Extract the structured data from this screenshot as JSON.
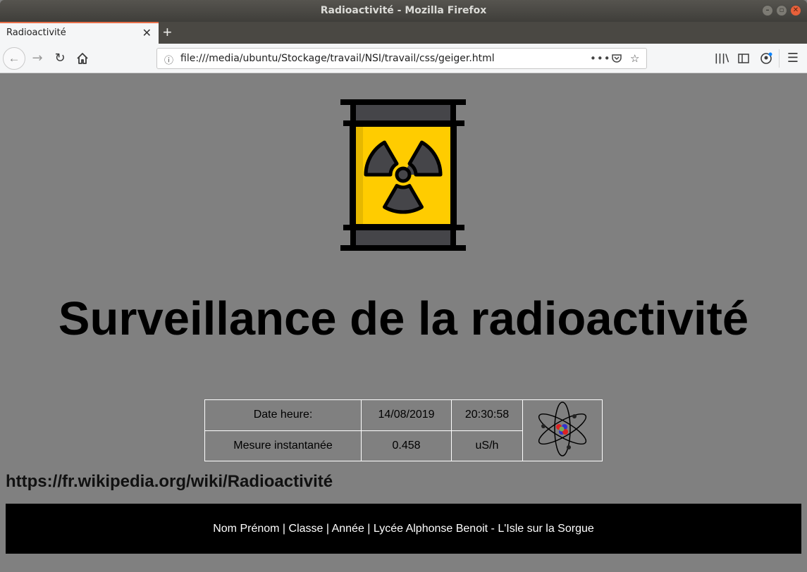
{
  "window": {
    "title": "Radioactivité - Mozilla Firefox"
  },
  "tabs": [
    {
      "label": "Radioactivité",
      "active": true
    }
  ],
  "toolbar": {
    "url": "file:///media/ubuntu/Stockage/travail/NSI/travail/css/geiger.html"
  },
  "page": {
    "heading": "Surveillance de la radioactivité",
    "table": {
      "rows": [
        {
          "label": "Date heure:",
          "value1": "14/08/2019",
          "value2": "20:30:58"
        },
        {
          "label": "Mesure instantanée",
          "value1": "0.458",
          "value2": "uS/h"
        }
      ]
    },
    "link_text": "https://fr.wikipedia.org/wiki/Radioactivité",
    "footer_text": "Nom Prénom | Classe | Année | Lycée Alphonse Benoit - L'Isle sur la Sorgue",
    "images": {
      "barrel": "radioactive-barrel-icon",
      "atom": "atom-icon"
    }
  },
  "colors": {
    "page_background": "#808080",
    "footer_background": "#000000",
    "barrel_yellow": "#ffcc00",
    "barrel_body": "#454549"
  }
}
